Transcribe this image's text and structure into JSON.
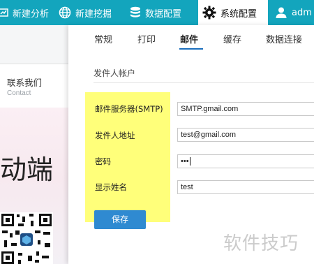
{
  "topbar": {
    "items": [
      {
        "label": "新建分析",
        "icon": "new-analysis-icon"
      },
      {
        "label": "新建挖掘",
        "icon": "globe-icon"
      },
      {
        "label": "数据配置",
        "icon": "database-icon"
      },
      {
        "label": "系统配置",
        "icon": "gear-icon"
      },
      {
        "label": "adm",
        "icon": "user-icon"
      }
    ],
    "background": "#13a5bd"
  },
  "background_page": {
    "contact_label": "联系我们",
    "contact_label_en": "Contact",
    "hero_text": "动端"
  },
  "tabs": [
    {
      "label": "常规"
    },
    {
      "label": "打印"
    },
    {
      "label": "邮件"
    },
    {
      "label": "缓存"
    },
    {
      "label": "数据连接"
    }
  ],
  "active_tab": "邮件",
  "form": {
    "section_title": "发件人帐户",
    "fields": [
      {
        "label": "邮件服务器(SMTP)",
        "value": "SMTP.gmail.com"
      },
      {
        "label": "发件人地址",
        "value": "test@gmail.com"
      },
      {
        "label": "密码",
        "value": "•••"
      },
      {
        "label": "显示姓名",
        "value": "test"
      }
    ],
    "save_label": "保存"
  },
  "watermark": "软件技巧",
  "colors": {
    "accent": "#2f8ad1",
    "tab_underline": "#1a6ebd",
    "highlight": "#ffff7a"
  }
}
